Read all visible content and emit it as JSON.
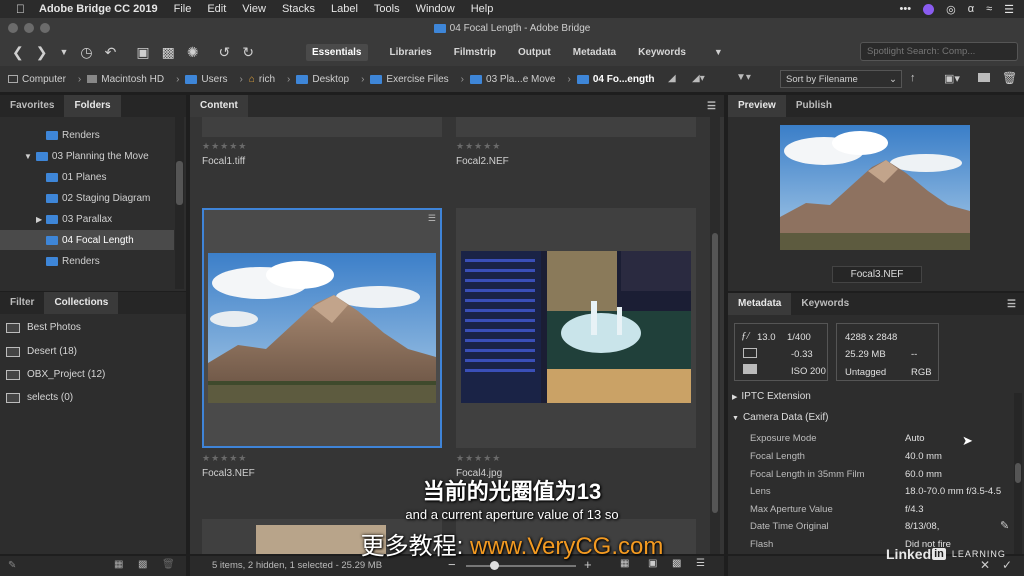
{
  "menubar": {
    "app_name": "Adobe Bridge CC 2019",
    "items": [
      "File",
      "Edit",
      "View",
      "Stacks",
      "Label",
      "Tools",
      "Window",
      "Help"
    ]
  },
  "window_title": "04 Focal Length - Adobe Bridge",
  "workspaces": [
    "Essentials",
    "Libraries",
    "Filmstrip",
    "Output",
    "Metadata",
    "Keywords"
  ],
  "search": {
    "placeholder": "Spotlight Search: Comp..."
  },
  "breadcrumbs": [
    "Computer",
    "Macintosh HD",
    "Users",
    "rich",
    "Desktop",
    "Exercise Files",
    "03 Pla...e Move",
    "04 Fo...ength"
  ],
  "sort": {
    "label": "Sort by Filename"
  },
  "left_tabs_top": [
    "Favorites",
    "Folders"
  ],
  "folders": [
    {
      "label": "Renders",
      "indent": 2
    },
    {
      "label": "03 Planning the Move",
      "indent": 1
    },
    {
      "label": "01 Planes",
      "indent": 2
    },
    {
      "label": "02 Staging Diagram",
      "indent": 2
    },
    {
      "label": "03 Parallax",
      "indent": 2
    },
    {
      "label": "04 Focal Length",
      "indent": 2
    },
    {
      "label": "Renders",
      "indent": 2
    }
  ],
  "left_tabs_bottom": [
    "Filter",
    "Collections"
  ],
  "collections": [
    {
      "label": "Best Photos"
    },
    {
      "label": "Desert  (18)"
    },
    {
      "label": "OBX_Project  (12)"
    },
    {
      "label": "selects  (0)"
    }
  ],
  "content": {
    "tab": "Content",
    "files": [
      "Focal1.tiff",
      "Focal2.NEF",
      "Focal3.NEF",
      "Focal4.jpg"
    ],
    "status": "5 items, 2 hidden, 1 selected - 25.29 MB"
  },
  "preview": {
    "tabs": [
      "Preview",
      "Publish"
    ],
    "filename": "Focal3.NEF"
  },
  "metadata": {
    "tabs": [
      "Metadata",
      "Keywords"
    ],
    "aperture": "13.0",
    "shutter": "1/400",
    "exposure": "-0.33",
    "iso": "ISO 200",
    "dimensions": "4288 x 2848",
    "size": "25.29 MB",
    "dashes": "--",
    "color_profile": "Untagged",
    "color_mode": "RGB",
    "sections": [
      "IPTC Extension",
      "Camera Data (Exif)"
    ],
    "exif": [
      {
        "label": "Exposure Mode",
        "value": "Auto"
      },
      {
        "label": "Focal Length",
        "value": "40.0 mm"
      },
      {
        "label": "Focal Length in 35mm Film",
        "value": "60.0 mm"
      },
      {
        "label": "Lens",
        "value": "18.0-70.0 mm f/3.5-4.5"
      },
      {
        "label": "Max Aperture Value",
        "value": "f/4.3"
      },
      {
        "label": "Date Time Original",
        "value": "8/13/08,"
      },
      {
        "label": "Flash",
        "value": "Did not fire"
      }
    ]
  },
  "subtitles": {
    "chinese": "当前的光圈值为13",
    "english": "and a current aperture value of 13 so",
    "promo_prefix": "更多教程:",
    "promo_url": "www.VeryCG.com"
  },
  "watermark": {
    "brand": "Linked",
    "brand_in": "in",
    "learning": "LEARNING"
  }
}
